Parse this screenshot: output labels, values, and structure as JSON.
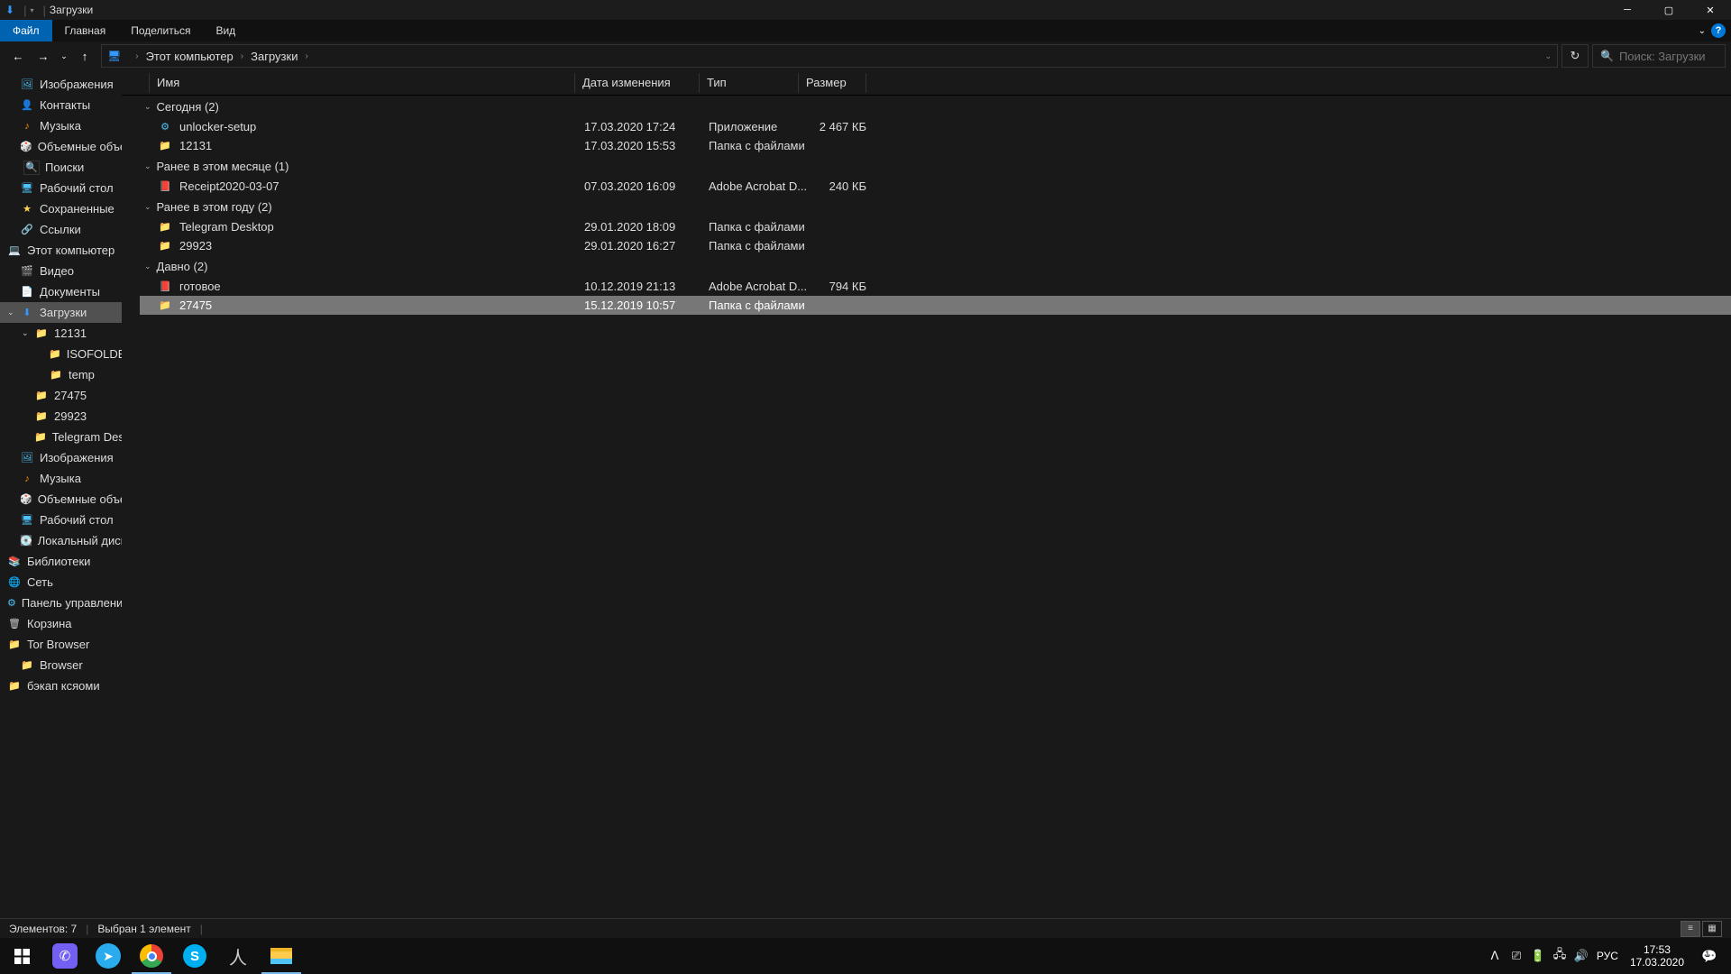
{
  "window": {
    "title": "Загрузки"
  },
  "ribbon": {
    "tabs": [
      "Файл",
      "Главная",
      "Поделиться",
      "Вид"
    ]
  },
  "breadcrumbs": [
    "Этот компьютер",
    "Загрузки"
  ],
  "search": {
    "placeholder": "Поиск: Загрузки"
  },
  "columns": {
    "name": "Имя",
    "date": "Дата изменения",
    "type": "Тип",
    "size": "Размер"
  },
  "sidebar": [
    {
      "label": "Изображения",
      "icon": "pic",
      "ind": 1
    },
    {
      "label": "Контакты",
      "icon": "user",
      "ind": 1
    },
    {
      "label": "Музыка",
      "icon": "music",
      "ind": 1
    },
    {
      "label": "Объемные объекты",
      "icon": "cube",
      "ind": 1
    },
    {
      "label": "Поиски",
      "icon": "search",
      "ind": 1
    },
    {
      "label": "Рабочий стол",
      "icon": "desktop",
      "ind": 1
    },
    {
      "label": "Сохраненные",
      "icon": "star",
      "ind": 1
    },
    {
      "label": "Ссылки",
      "icon": "link",
      "ind": 1
    },
    {
      "label": "Этот компьютер",
      "icon": "pc",
      "ind": 0,
      "exp": true
    },
    {
      "label": "Видео",
      "icon": "video",
      "ind": 1
    },
    {
      "label": "Документы",
      "icon": "doc",
      "ind": 1
    },
    {
      "label": "Загрузки",
      "icon": "down",
      "ind": 1,
      "sel": true,
      "exp": true
    },
    {
      "label": "12131",
      "icon": "folder",
      "ind": 2,
      "exp": true
    },
    {
      "label": "ISOFOLDER",
      "icon": "folder",
      "ind": 3
    },
    {
      "label": "temp",
      "icon": "folder",
      "ind": 3
    },
    {
      "label": "27475",
      "icon": "folder",
      "ind": 2
    },
    {
      "label": "29923",
      "icon": "folder",
      "ind": 2
    },
    {
      "label": "Telegram Desktop",
      "icon": "folder",
      "ind": 2
    },
    {
      "label": "Изображения",
      "icon": "pic",
      "ind": 1
    },
    {
      "label": "Музыка",
      "icon": "music",
      "ind": 1
    },
    {
      "label": "Объемные объекты",
      "icon": "cube",
      "ind": 1
    },
    {
      "label": "Рабочий стол",
      "icon": "desktop",
      "ind": 1
    },
    {
      "label": "Локальный диск",
      "icon": "disk",
      "ind": 1
    },
    {
      "label": "Библиотеки",
      "icon": "lib",
      "ind": 0
    },
    {
      "label": "Сеть",
      "icon": "net",
      "ind": 0
    },
    {
      "label": "Панель управления",
      "icon": "cpl",
      "ind": 0
    },
    {
      "label": "Корзина",
      "icon": "trash",
      "ind": 0
    },
    {
      "label": "Tor Browser",
      "icon": "folder",
      "ind": 0
    },
    {
      "label": "Browser",
      "icon": "folder",
      "ind": 1
    },
    {
      "label": "бэкап ксяоми",
      "icon": "folder",
      "ind": 0
    }
  ],
  "groups": [
    {
      "label": "Сегодня (2)",
      "items": [
        {
          "name": "unlocker-setup",
          "icon": "app",
          "date": "17.03.2020 17:24",
          "type": "Приложение",
          "size": "2 467 КБ"
        },
        {
          "name": "12131",
          "icon": "folder",
          "date": "17.03.2020 15:53",
          "type": "Папка с файлами",
          "size": ""
        }
      ]
    },
    {
      "label": "Ранее в этом месяце (1)",
      "items": [
        {
          "name": "Receipt2020-03-07",
          "icon": "pdf",
          "date": "07.03.2020 16:09",
          "type": "Adobe Acrobat D...",
          "size": "240 КБ"
        }
      ]
    },
    {
      "label": "Ранее в этом году (2)",
      "items": [
        {
          "name": "Telegram Desktop",
          "icon": "folder",
          "date": "29.01.2020 18:09",
          "type": "Папка с файлами",
          "size": ""
        },
        {
          "name": "29923",
          "icon": "folder",
          "date": "29.01.2020 16:27",
          "type": "Папка с файлами",
          "size": ""
        }
      ]
    },
    {
      "label": "Давно (2)",
      "items": [
        {
          "name": "готовое",
          "icon": "pdf",
          "date": "10.12.2019 21:13",
          "type": "Adobe Acrobat D...",
          "size": "794 КБ"
        },
        {
          "name": "27475",
          "icon": "folder",
          "date": "15.12.2019 10:57",
          "type": "Папка с файлами",
          "size": "",
          "sel": true
        }
      ]
    }
  ],
  "status": {
    "items": "Элементов: 7",
    "selected": "Выбран 1 элемент"
  },
  "tray": {
    "lang": "РУС",
    "time": "17:53",
    "date": "17.03.2020",
    "notif": "1"
  }
}
